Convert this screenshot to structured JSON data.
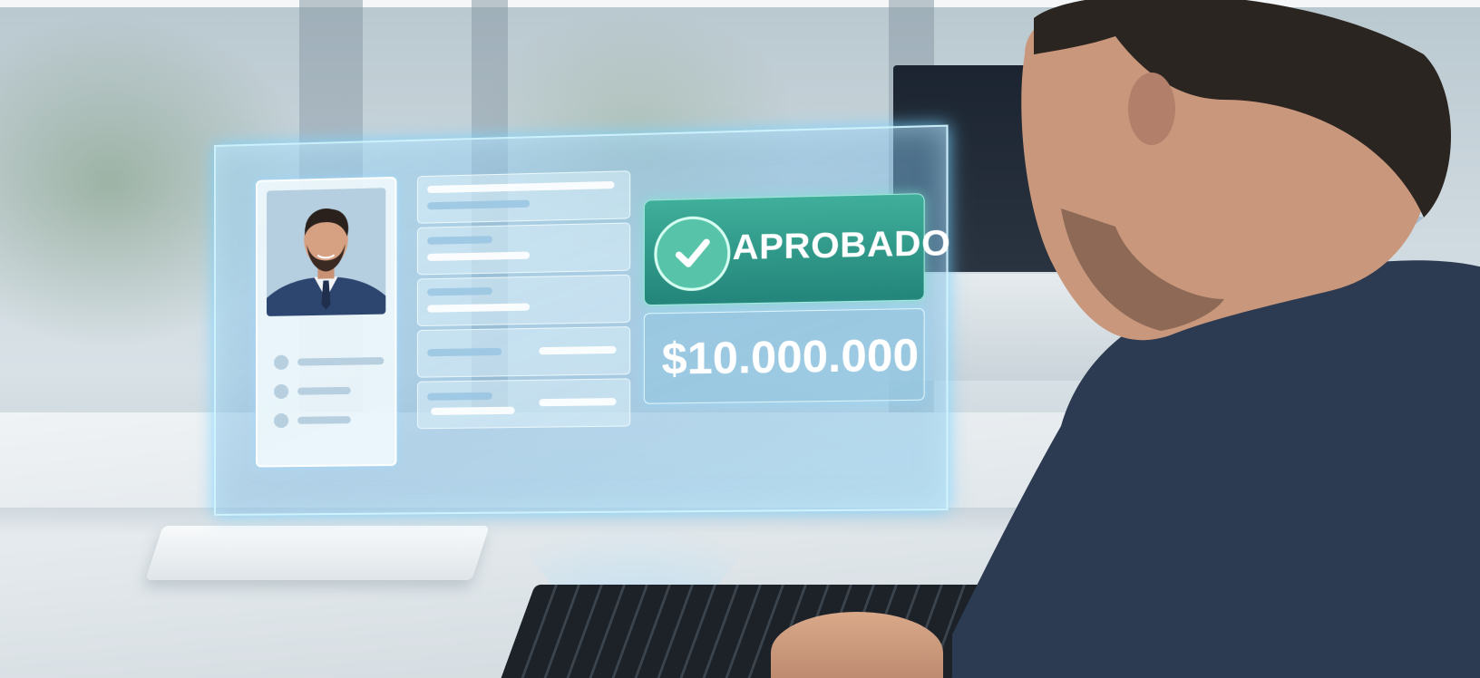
{
  "hologram": {
    "status_label": "APROBADO",
    "amount": "$10.000.000"
  },
  "icons": {
    "status": "check-icon",
    "profile": "avatar-photo"
  },
  "colors": {
    "approved_panel": "#2f9a8a",
    "hologram_glow": "#78d2ff",
    "amount_panel": "#96c8e1"
  }
}
